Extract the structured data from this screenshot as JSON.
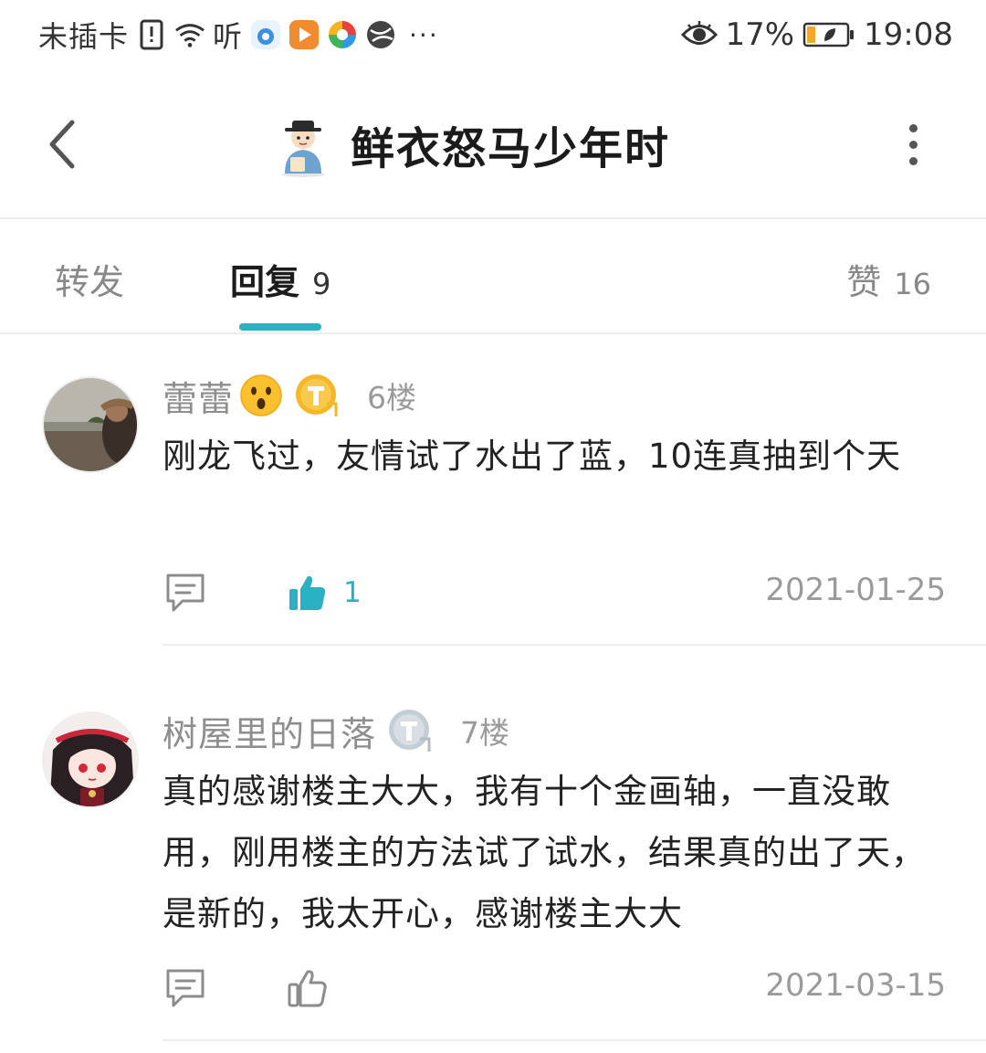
{
  "status_bar": {
    "carrier": "未插卡",
    "listen_label": "听",
    "battery_percent": "17%",
    "time": "19:08",
    "more": "···",
    "icons": [
      "sim-alert-icon",
      "wifi-icon",
      "app-icon",
      "video-app-icon",
      "browser-icon",
      "globe-icon",
      "eye-icon",
      "battery-icon"
    ]
  },
  "header": {
    "title": "鲜衣怒马少年时",
    "back_icon": "chevron-left-icon",
    "more_icon": "vertical-dots-icon"
  },
  "tabs": {
    "forward": {
      "label": "转发"
    },
    "reply": {
      "label": "回复",
      "count": "9"
    },
    "like": {
      "label": "赞",
      "count": "16"
    },
    "active": "reply",
    "accent_color": "#2bb2c2"
  },
  "comments": [
    {
      "username": "蕾蕾",
      "floor": "6楼",
      "text": "刚龙飞过，友情试了水出了蓝，10连真抽到个天",
      "likes": "1",
      "liked": true,
      "date": "2021-01-25",
      "badge": "gold-badge-icon"
    },
    {
      "username": "树屋里的日落",
      "floor": "7楼",
      "text": "真的感谢楼主大大，我有十个金画轴，一直没敢用，刚用楼主的方法试了试水，结果真的出了天，是新的，我太开心，感谢楼主大大",
      "likes": "",
      "liked": false,
      "date": "2021-03-15",
      "badge": "silver-badge-icon"
    }
  ]
}
